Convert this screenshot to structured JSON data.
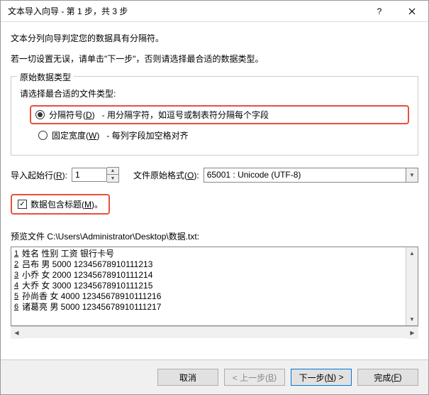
{
  "title": "文本导入向导 - 第 1 步，共 3 步",
  "intro1": "文本分列向导判定您的数据具有分隔符。",
  "intro2": "若一切设置无误，请单击\"下一步\"，否则请选择最合适的数据类型。",
  "fieldset_label": "原始数据类型",
  "prompt": "请选择最合适的文件类型:",
  "radio_delim_label": "分隔符号(D)",
  "radio_delim_desc": "- 用分隔字符，如逗号或制表符分隔每个字段",
  "radio_fixed_label": "固定宽度(W)",
  "radio_fixed_desc": "- 每列字段加空格对齐",
  "start_row_label": "导入起始行(R):",
  "start_row_value": "1",
  "encoding_label": "文件原始格式(O):",
  "encoding_value": "65001 : Unicode (UTF-8)",
  "header_checkbox": "数据包含标题(M)。",
  "preview_label": "预览文件 C:\\Users\\Administrator\\Desktop\\数据.txt:",
  "preview_lines": [
    "姓名 性别 工资 银行卡号",
    "吕布 男 5000 12345678910111213",
    "小乔 女 2000 12345678910111214",
    "大乔 女 3000 12345678910111215",
    "孙尚香 女 4000 12345678910111216",
    "诸葛亮 男 5000 12345678910111217"
  ],
  "btn_cancel": "取消",
  "btn_back": "< 上一步(B)",
  "btn_next": "下一步(N) >",
  "btn_finish": "完成(F)"
}
